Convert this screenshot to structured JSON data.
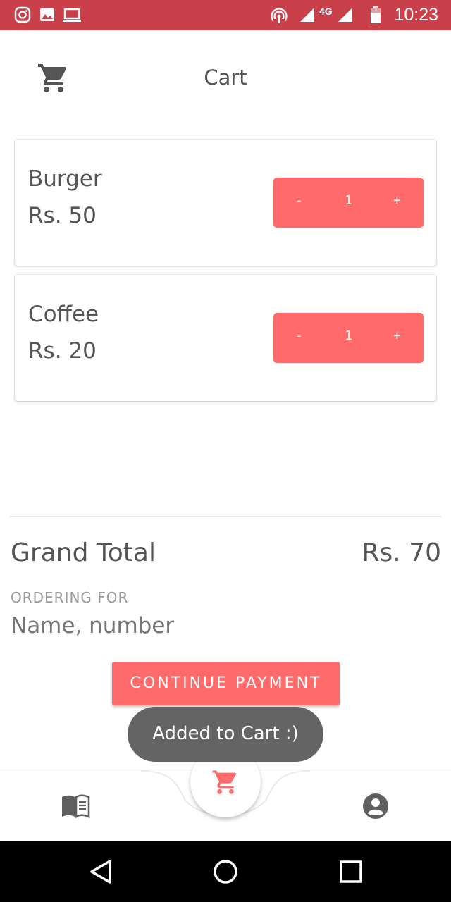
{
  "status_bar": {
    "time": "10:23",
    "network": "4G",
    "icons": [
      "instagram-icon",
      "image-icon",
      "laptop-icon",
      "hotspot-icon",
      "signal-icon",
      "battery-icon"
    ],
    "background": "#c9404a"
  },
  "header": {
    "title": "Cart",
    "icon": "cart-icon"
  },
  "cart": {
    "items": [
      {
        "name": "Burger",
        "price": "Rs. 50",
        "quantity": "1",
        "minus": "-",
        "plus": "+"
      },
      {
        "name": "Coffee",
        "price": "Rs. 20",
        "quantity": "1",
        "minus": "-",
        "plus": "+"
      }
    ]
  },
  "summary": {
    "grand_total_label": "Grand Total",
    "grand_total_value": "Rs. 70",
    "ordering_for_label": "ORDERING FOR",
    "ordering_for_placeholder": "Name, number"
  },
  "actions": {
    "continue_label": "CONTINUE PAYMENT"
  },
  "toast": {
    "message": "Added to Cart :)"
  },
  "bottom_nav": {
    "items": [
      "menu-book-icon",
      "cart-icon",
      "profile-icon"
    ]
  },
  "colors": {
    "accent": "#ff6b6b",
    "text": "#555555",
    "muted": "#9a9a9a",
    "toast": "#646464"
  }
}
